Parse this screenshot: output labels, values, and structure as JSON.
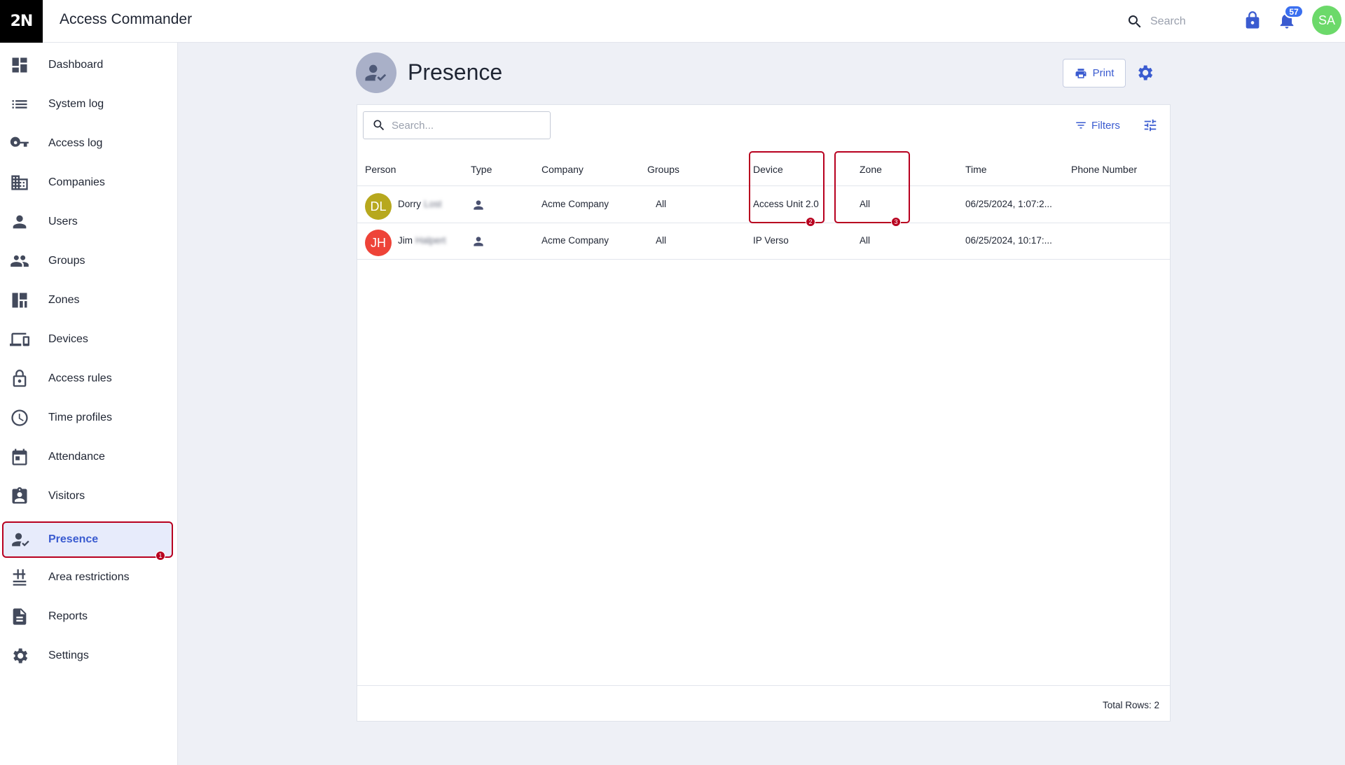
{
  "app": {
    "logo": "2N",
    "title": "Access Commander"
  },
  "header": {
    "search_label": "Search",
    "notification_count": "57",
    "user_initials": "SA",
    "user_avatar_color": "#6cd96a",
    "accent_color": "#3a5bd0"
  },
  "sidebar": {
    "items": [
      {
        "label": "Dashboard",
        "icon": "dashboard-icon"
      },
      {
        "label": "System log",
        "icon": "list-icon"
      },
      {
        "label": "Access log",
        "icon": "key-icon"
      },
      {
        "label": "Companies",
        "icon": "building-icon"
      },
      {
        "label": "Users",
        "icon": "person-icon"
      },
      {
        "label": "Groups",
        "icon": "people-icon"
      },
      {
        "label": "Zones",
        "icon": "zones-icon"
      },
      {
        "label": "Devices",
        "icon": "devices-icon"
      },
      {
        "label": "Access rules",
        "icon": "lock-open-icon"
      },
      {
        "label": "Time profiles",
        "icon": "clock-icon"
      },
      {
        "label": "Attendance",
        "icon": "calendar-icon"
      },
      {
        "label": "Visitors",
        "icon": "visitor-badge-icon"
      },
      {
        "label": "Presence",
        "icon": "person-check-icon",
        "active": true,
        "step": "1"
      },
      {
        "label": "Area restrictions",
        "icon": "area-restriction-icon"
      },
      {
        "label": "Reports",
        "icon": "document-icon"
      },
      {
        "label": "Settings",
        "icon": "gear-icon"
      }
    ]
  },
  "page": {
    "title": "Presence",
    "print_label": "Print"
  },
  "table": {
    "search_placeholder": "Search...",
    "filters_label": "Filters",
    "columns": [
      "Person",
      "Type",
      "Company",
      "Groups",
      "Device",
      "Zone",
      "Time",
      "Phone Number"
    ],
    "rows": [
      {
        "initials": "DL",
        "avatar_color": "#b7a81e",
        "first_name": "Dorry",
        "last_name": "Lost",
        "type": "user",
        "company": "Acme Company",
        "groups": "All",
        "device": "Access Unit 2.0",
        "zone": "All",
        "time": "06/25/2024, 1:07:2...",
        "phone": ""
      },
      {
        "initials": "JH",
        "avatar_color": "#ee4338",
        "first_name": "Jim",
        "last_name": "Halpert",
        "type": "user",
        "company": "Acme Company",
        "groups": "All",
        "device": "IP Verso",
        "zone": "All",
        "time": "06/25/2024, 10:17:...",
        "phone": ""
      }
    ],
    "total_rows": "Total Rows: 2"
  },
  "annotations": {
    "device_step": "2",
    "zone_step": "3",
    "highlight_color": "#b8001f"
  }
}
